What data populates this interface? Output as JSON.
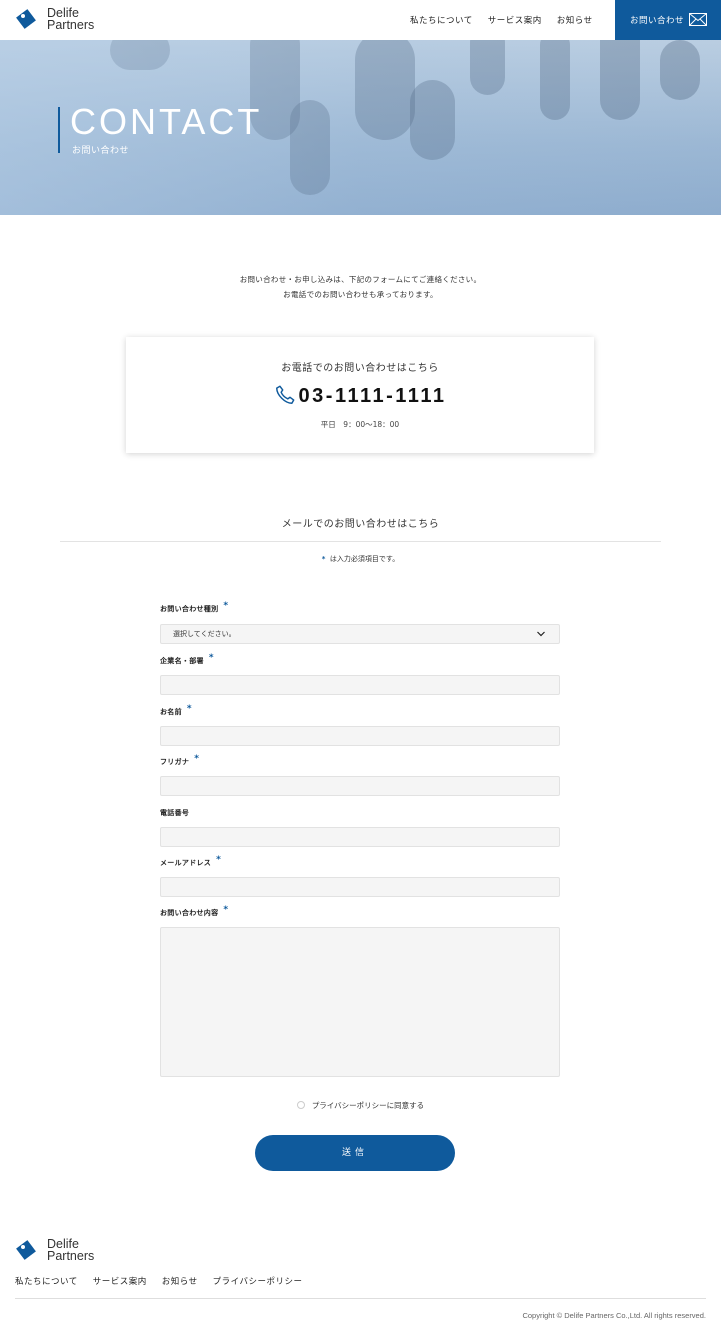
{
  "brand": {
    "name_line1": "Delife",
    "name_line2": "Partners",
    "accent_color": "#0f5a9c"
  },
  "header": {
    "nav": [
      "私たちについて",
      "サービス案内",
      "お知らせ"
    ],
    "cta_label": "お問い合わせ",
    "cta_icon": "mail-icon"
  },
  "hero": {
    "title": "CONTACT",
    "subtitle": "お問い合わせ"
  },
  "intro": {
    "line1": "お問い合わせ・お申し込みは、下記のフォームにてご連絡ください。",
    "line2": "お電話でのお問い合わせも承っております。"
  },
  "phone": {
    "heading": "お電話でのお問い合わせはこちら",
    "number": "03-1111-1111",
    "hours": "平日　9：00～18：00",
    "icon": "phone-icon"
  },
  "mail_form": {
    "heading": "メールでのお問い合わせはこちら",
    "required_star": "*",
    "required_note": "は入力必須項目です。",
    "fields": {
      "inquiry_type": {
        "label": "お問い合わせ種別",
        "required": true,
        "value": "選択してください。"
      },
      "company": {
        "label": "企業名・部署",
        "required": true,
        "value": ""
      },
      "name": {
        "label": "お名前",
        "required": true,
        "value": ""
      },
      "furigana": {
        "label": "フリガナ",
        "required": true,
        "value": ""
      },
      "phone": {
        "label": "電話番号",
        "required": false,
        "value": ""
      },
      "email": {
        "label": "メールアドレス",
        "required": true,
        "value": ""
      },
      "message": {
        "label": "お問い合わせ内容",
        "required": true,
        "value": ""
      }
    },
    "privacy_label": "プライバシーポリシーに同意する",
    "privacy_checked": false,
    "submit_label": "送信"
  },
  "footer": {
    "nav": [
      "私たちについて",
      "サービス案内",
      "お知らせ",
      "プライバシーポリシー"
    ],
    "copyright": "Copyright © Delife Partners Co.,Ltd.  All rights reserved."
  }
}
